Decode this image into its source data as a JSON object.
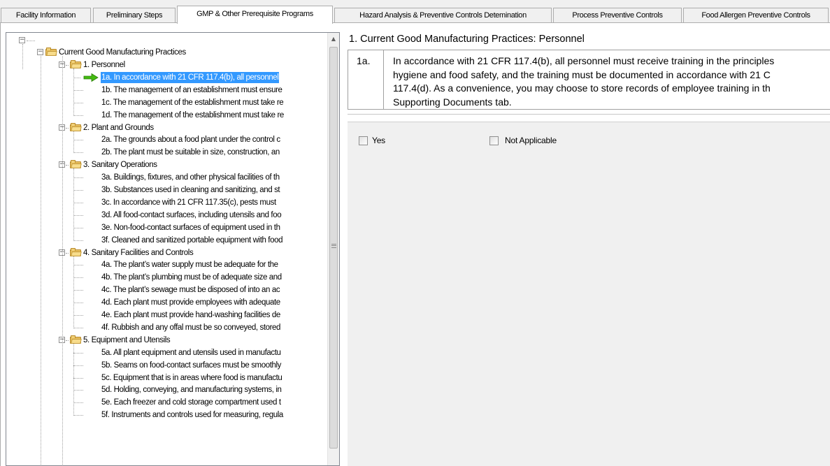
{
  "tabs": [
    {
      "label": "Facility Information",
      "active": false
    },
    {
      "label": "Preliminary Steps",
      "active": false
    },
    {
      "label": "GMP & Other Prerequisite Programs",
      "active": true
    },
    {
      "label": "Hazard Analysis & Preventive Controls Detemination",
      "active": false
    },
    {
      "label": "Process Preventive Controls",
      "active": false
    },
    {
      "label": "Food Allergen Preventive Controls",
      "active": false
    }
  ],
  "tree": {
    "root_label": "",
    "category": "Current Good Manufacturing Practices",
    "groups": [
      {
        "label": "1. Personnel",
        "items": [
          "1a. In accordance with 21 CFR 117.4(b), all personnel",
          "1b. The management of an establishment must ensure",
          "1c. The management of the establishment must take re",
          "1d. The management of the establishment must take re"
        ]
      },
      {
        "label": "2. Plant and Grounds",
        "items": [
          "2a. The grounds about a food plant under the control c",
          "2b. The plant must be suitable in size, construction, an"
        ]
      },
      {
        "label": "3. Sanitary Operations",
        "items": [
          "3a. Buildings, fixtures, and other physical facilities of th",
          "3b. Substances used in cleaning and sanitizing, and st",
          "3c. In accordance with 21 CFR 117.35(c), pests must",
          "3d. All food-contact surfaces, including utensils and foo",
          "3e. Non-food-contact surfaces of equipment used in th",
          "3f. Cleaned and sanitized portable equipment with food"
        ]
      },
      {
        "label": "4. Sanitary Facilities and Controls",
        "items": [
          "4a. The plant’s water supply must be adequate for the",
          "4b. The plant’s plumbing must be of adequate size and",
          "4c. The plant’s sewage must be disposed of into an ac",
          "4d. Each plant must provide employees with adequate",
          "4e. Each plant must provide hand-washing facilities de",
          "4f. Rubbish and any offal must be so conveyed, stored"
        ]
      },
      {
        "label": "5. Equipment and Utensils",
        "items": [
          "5a. All plant equipment and utensils used in manufactu",
          "5b. Seams on food-contact surfaces must be smoothly",
          "5c. Equipment that is in areas where food is manufactu",
          "5d. Holding, conveying, and manufacturing systems, in",
          "5e. Each freezer and cold storage compartment used t",
          "5f. Instruments and controls used for measuring, regula"
        ]
      }
    ],
    "selected_item": "1a. In accordance with 21 CFR 117.4(b), all personnel",
    "icons": {
      "folder": "folder-open-icon",
      "arrow": "green-arrow-icon",
      "expander": "minus-icon"
    }
  },
  "panel": {
    "title": "1. Current Good Manufacturing Practices: Personnel",
    "question_number": "1a.",
    "question_lines": [
      "In accordance with 21 CFR 117.4(b), all personnel must receive training in the principles",
      "hygiene and food safety, and the training must be documented in accordance with 21 C",
      "117.4(d). As a convenience, you may choose to store records of employee training in th",
      "Supporting Documents tab."
    ],
    "yes_label": "Yes",
    "na_label": "Not Applicable"
  },
  "colors": {
    "selection": "#3399ff",
    "arrow": "#44bb11",
    "folder": "#e8c060"
  }
}
